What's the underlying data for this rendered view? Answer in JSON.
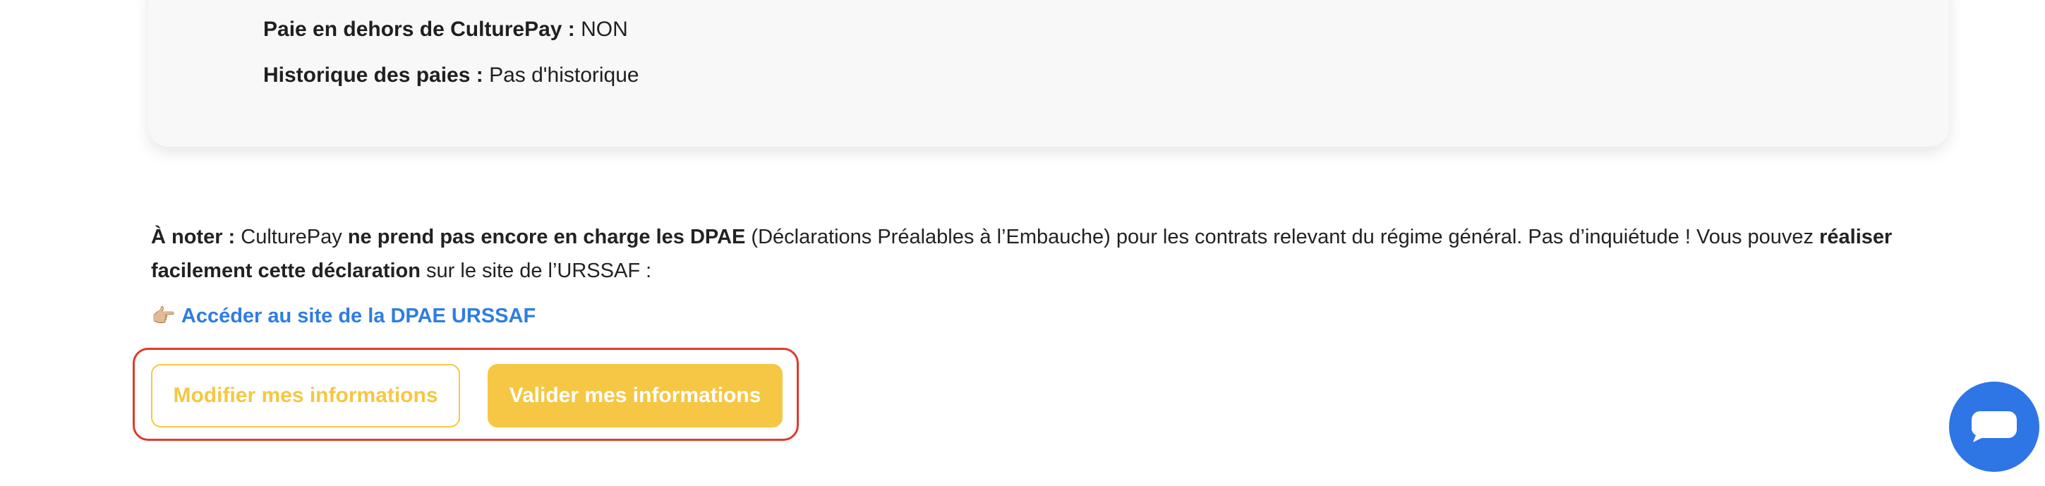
{
  "card": {
    "rows": [
      {
        "label": "Paie en dehors de CulturePay :",
        "value": "NON"
      },
      {
        "label": "Historique des paies :",
        "value": "Pas d'historique"
      }
    ]
  },
  "note": {
    "prefix": "À noter :",
    "t1": "CulturePay",
    "b1": "ne prend pas encore en charge les DPAE",
    "t2": "(Déclarations Préalables à l’Embauche) pour les contrats relevant du régime général. Pas d’inquiétude ! Vous pouvez",
    "b2": "réaliser facilement cette déclaration",
    "t3": "sur le site de l’URSSAF :"
  },
  "link": {
    "emoji": "👉🏼",
    "label": "Accéder au site de la DPAE URSSAF"
  },
  "actions": {
    "modify_label": "Modifier mes informations",
    "validate_label": "Valider mes informations"
  },
  "colors": {
    "accent_yellow": "#f6c744",
    "link_blue": "#2f7de1",
    "chat_blue": "#2e75e6",
    "highlight_red": "#e03a2a",
    "card_bg": "#f8f8f8"
  },
  "icons": {
    "chat": "chat-bubble-icon",
    "hand": "pointing-hand-icon"
  }
}
